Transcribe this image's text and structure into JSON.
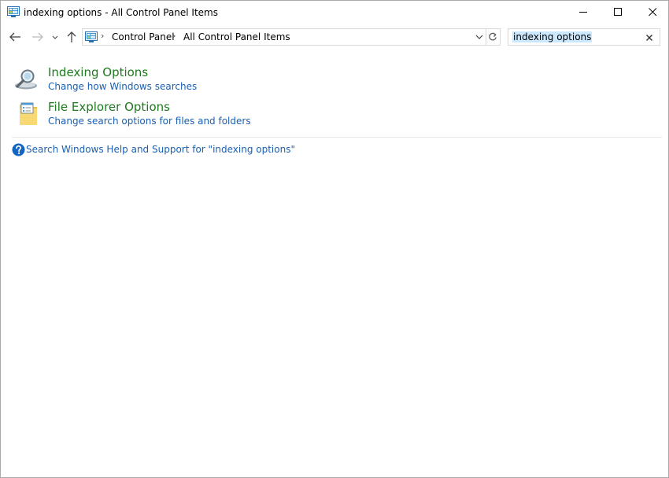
{
  "window": {
    "title": "indexing options - All Control Panel Items"
  },
  "nav": {
    "breadcrumb": [
      "Control Panel",
      "All Control Panel Items"
    ],
    "search": {
      "value": "indexing options"
    }
  },
  "results": [
    {
      "title": "Indexing Options",
      "subtitle": "Change how Windows searches",
      "icon": "magnifier-icon"
    },
    {
      "title": "File Explorer Options",
      "subtitle": "Change search options for files and folders",
      "icon": "folder-options-icon"
    }
  ],
  "help": {
    "text": "Search Windows Help and Support for \"indexing options\"",
    "icon": "question-icon"
  },
  "colors": {
    "link_blue": "#1a5fb4",
    "title_green": "#1e7a1e",
    "selection": "#cce8ff"
  }
}
